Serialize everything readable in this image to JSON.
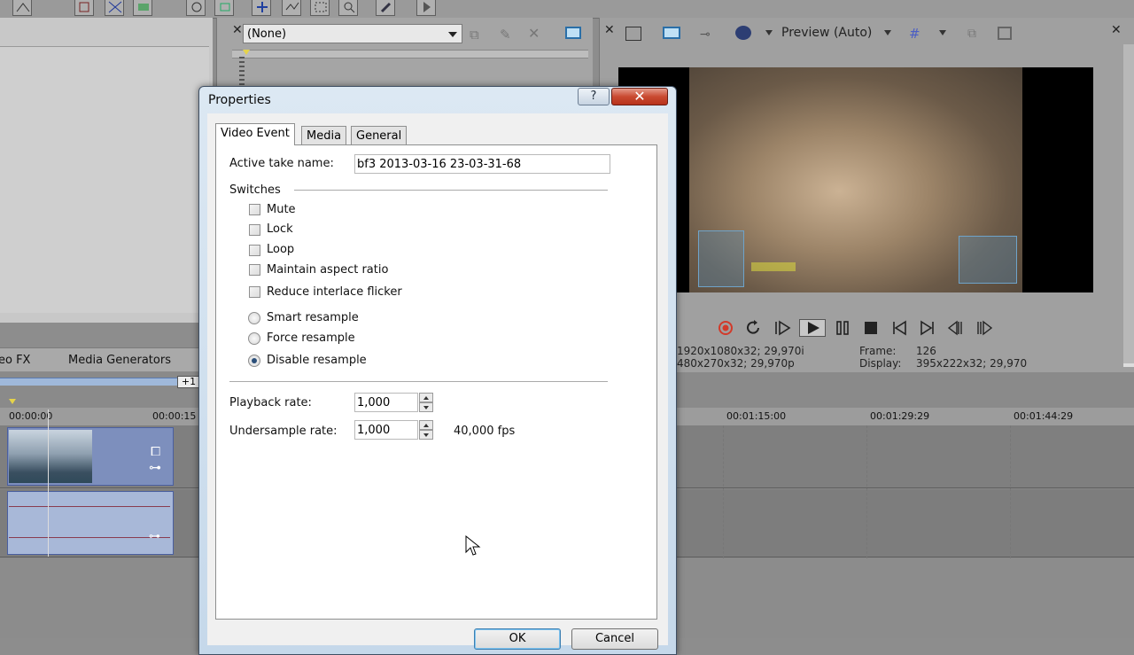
{
  "fx_panel": {
    "chain_select_value": "(None)"
  },
  "left_panel": {
    "tabs": [
      {
        "label": "eo FX"
      },
      {
        "label": "Media Generators"
      }
    ]
  },
  "preview": {
    "mode_label": "Preview (Auto)",
    "info_project": "1920x1080x32; 29,970i",
    "info_preview": "480x270x32; 29,970p",
    "frame_label": "Frame:",
    "frame_value": "126",
    "display_label": "Display:",
    "display_value": "395x222x32; 29,970"
  },
  "timeline": {
    "plus_badge": "+1",
    "timecodes": [
      "00:00:00",
      "00:00:15",
      "00:01:15:00",
      "00:01:29:29",
      "00:01:44:29"
    ]
  },
  "dialog": {
    "title": "Properties",
    "help_label": "?",
    "close_label": "✕",
    "tabs": [
      {
        "label": "Video Event"
      },
      {
        "label": "Media"
      },
      {
        "label": "General"
      }
    ],
    "active_take_label": "Active take name:",
    "active_take_value": "bf3 2013-03-16 23-03-31-68",
    "switches_label": "Switches",
    "checkboxes": [
      {
        "label": "Mute",
        "checked": false
      },
      {
        "label": "Lock",
        "checked": false
      },
      {
        "label": "Loop",
        "checked": false
      },
      {
        "label": "Maintain aspect ratio",
        "checked": false
      },
      {
        "label": "Reduce interlace flicker",
        "checked": false
      }
    ],
    "radios": [
      {
        "label": "Smart resample",
        "selected": false
      },
      {
        "label": "Force resample",
        "selected": false
      },
      {
        "label": "Disable resample",
        "selected": true
      }
    ],
    "playback_rate_label": "Playback rate:",
    "playback_rate_value": "1,000",
    "undersample_rate_label": "Undersample rate:",
    "undersample_rate_value": "1,000",
    "undersample_fps": "40,000 fps",
    "ok_label": "OK",
    "cancel_label": "Cancel"
  },
  "colors": {
    "dialog_title_bar": "#c5d8ea",
    "close_button": "#c94a31",
    "clip_video": "#7d8fbd",
    "record_button": "#d23a2a"
  }
}
